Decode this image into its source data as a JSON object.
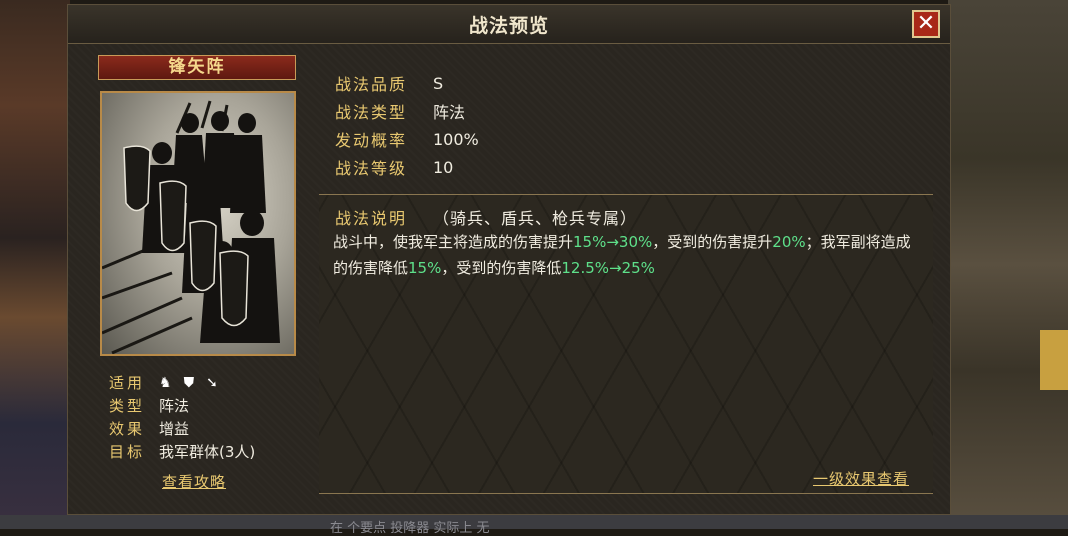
{
  "window": {
    "title": "战法预览",
    "close_label": "✕"
  },
  "skill": {
    "name": "锋矢阵",
    "info": [
      {
        "key": "适用",
        "value": "",
        "icons": [
          "cavalry-icon",
          "shield-icon",
          "spear-icon"
        ]
      },
      {
        "key": "类型",
        "value": "阵法"
      },
      {
        "key": "效果",
        "value": "增益"
      },
      {
        "key": "目标",
        "value": "我军群体(3人)"
      }
    ],
    "guide_link": "查看攻略"
  },
  "stats": [
    {
      "key": "战法品质",
      "value": "S"
    },
    {
      "key": "战法类型",
      "value": "阵法"
    },
    {
      "key": "发动概率",
      "value": "100%"
    },
    {
      "key": "战法等级",
      "value": "10"
    }
  ],
  "description": {
    "label": "战法说明",
    "tag": "（骑兵、盾兵、枪兵专属）",
    "segments": [
      {
        "text": "战斗中，使我军主将造成的伤害提升",
        "hl": false
      },
      {
        "text": "15%→30%",
        "hl": true
      },
      {
        "text": "，受到的伤害提升",
        "hl": false
      },
      {
        "text": "20%",
        "hl": true
      },
      {
        "text": "；我军副将造成的伤害降低",
        "hl": false
      },
      {
        "text": "15%",
        "hl": true
      },
      {
        "text": "，受到的伤害降低",
        "hl": false
      },
      {
        "text": "12.5%→25%",
        "hl": true
      }
    ],
    "effects_link": "一级效果查看"
  },
  "background_caption": "在    个要点  投降器     实际上  无",
  "colors": {
    "accent": "#e8c870",
    "highlight": "#5ee08a",
    "close": "#a82818"
  }
}
